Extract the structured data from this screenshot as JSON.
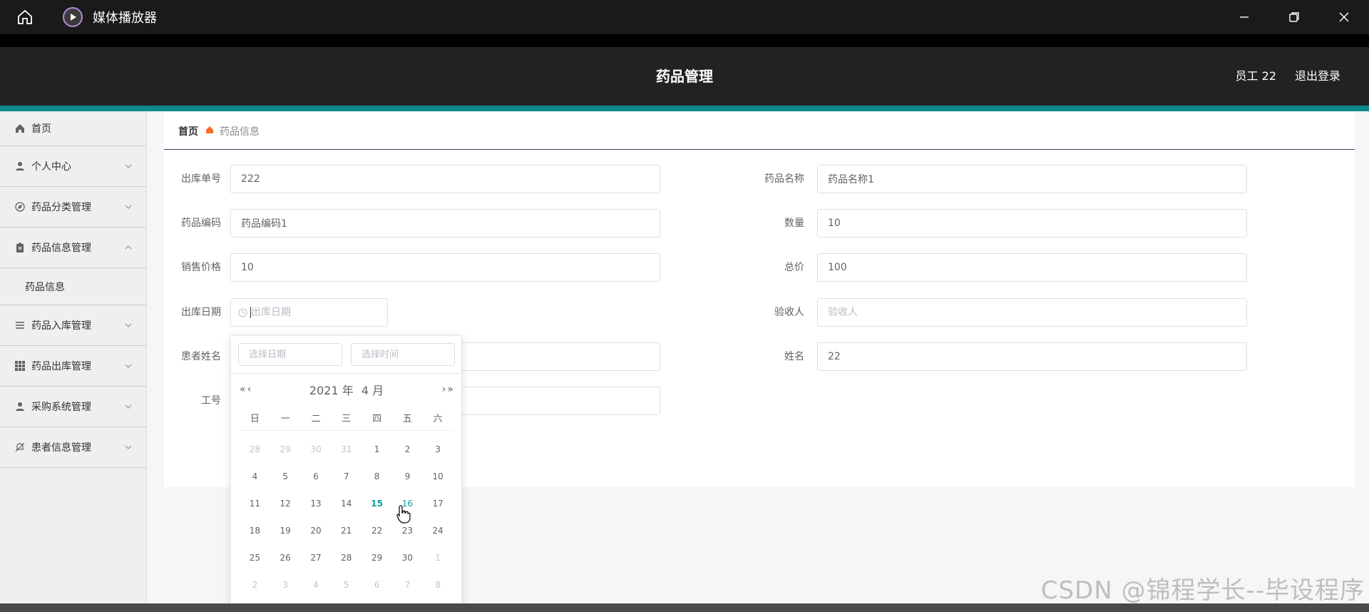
{
  "window": {
    "title": "媒体播放器"
  },
  "header": {
    "title": "药品管理",
    "user": "员工 22",
    "logout": "退出登录"
  },
  "sidebar": {
    "items": [
      {
        "label": "首页",
        "icon": "home-icon",
        "expanded": false
      },
      {
        "label": "个人中心",
        "icon": "user-icon",
        "expanded": false
      },
      {
        "label": "药品分类管理",
        "icon": "compass-icon",
        "expanded": false
      },
      {
        "label": "药品信息管理",
        "icon": "clipboard-icon",
        "expanded": true
      },
      {
        "label": "药品入库管理",
        "icon": "list-icon",
        "expanded": false
      },
      {
        "label": "药品出库管理",
        "icon": "grid-icon",
        "expanded": false
      },
      {
        "label": "采购系统管理",
        "icon": "user-icon",
        "expanded": false
      },
      {
        "label": "患者信息管理",
        "icon": "bell-off-icon",
        "expanded": false
      }
    ],
    "subitem": "药品信息"
  },
  "breadcrumb": {
    "home": "首页",
    "current": "药品信息"
  },
  "form": {
    "outbound_no": {
      "label": "出库单号",
      "value": "222"
    },
    "drug_name": {
      "label": "药品名称",
      "value": "药品名称1"
    },
    "drug_code": {
      "label": "药品编码",
      "value": "药品编码1"
    },
    "quantity": {
      "label": "数量",
      "value": "10"
    },
    "sale_price": {
      "label": "销售价格",
      "value": "10"
    },
    "total_price": {
      "label": "总价",
      "value": "100"
    },
    "outbound_date": {
      "label": "出库日期",
      "value": "",
      "placeholder": "出库日期"
    },
    "receiver": {
      "label": "验收人",
      "value": "",
      "placeholder": "验收人"
    },
    "patient_name": {
      "label": "患者姓名",
      "value": ""
    },
    "name": {
      "label": "姓名",
      "value": "22"
    },
    "employee_no": {
      "label": "工号",
      "value": ""
    }
  },
  "datepicker": {
    "date_placeholder": "选择日期",
    "time_placeholder": "选择时间",
    "year": "2021 年",
    "month": "4 月",
    "weekdays": [
      "日",
      "一",
      "二",
      "三",
      "四",
      "五",
      "六"
    ],
    "rows": [
      [
        {
          "d": "28",
          "o": true
        },
        {
          "d": "29",
          "o": true
        },
        {
          "d": "30",
          "o": true
        },
        {
          "d": "31",
          "o": true
        },
        {
          "d": "1"
        },
        {
          "d": "2"
        },
        {
          "d": "3"
        }
      ],
      [
        {
          "d": "4"
        },
        {
          "d": "5"
        },
        {
          "d": "6"
        },
        {
          "d": "7"
        },
        {
          "d": "8"
        },
        {
          "d": "9"
        },
        {
          "d": "10"
        }
      ],
      [
        {
          "d": "11"
        },
        {
          "d": "12"
        },
        {
          "d": "13"
        },
        {
          "d": "14"
        },
        {
          "d": "15",
          "t": true
        },
        {
          "d": "16",
          "h": true
        },
        {
          "d": "17"
        }
      ],
      [
        {
          "d": "18"
        },
        {
          "d": "19"
        },
        {
          "d": "20"
        },
        {
          "d": "21"
        },
        {
          "d": "22"
        },
        {
          "d": "23"
        },
        {
          "d": "24"
        }
      ],
      [
        {
          "d": "25"
        },
        {
          "d": "26"
        },
        {
          "d": "27"
        },
        {
          "d": "28"
        },
        {
          "d": "29"
        },
        {
          "d": "30"
        },
        {
          "d": "1",
          "o": true
        }
      ],
      [
        {
          "d": "2",
          "o": true
        },
        {
          "d": "3",
          "o": true
        },
        {
          "d": "4",
          "o": true
        },
        {
          "d": "5",
          "o": true
        },
        {
          "d": "6",
          "o": true
        },
        {
          "d": "7",
          "o": true
        },
        {
          "d": "8",
          "o": true
        }
      ]
    ]
  },
  "watermark": "CSDN @锦程学长--毕设程序",
  "colors": {
    "accent": "#0a8a8a",
    "header_bg": "#222222",
    "today": "#0a9c9c"
  }
}
